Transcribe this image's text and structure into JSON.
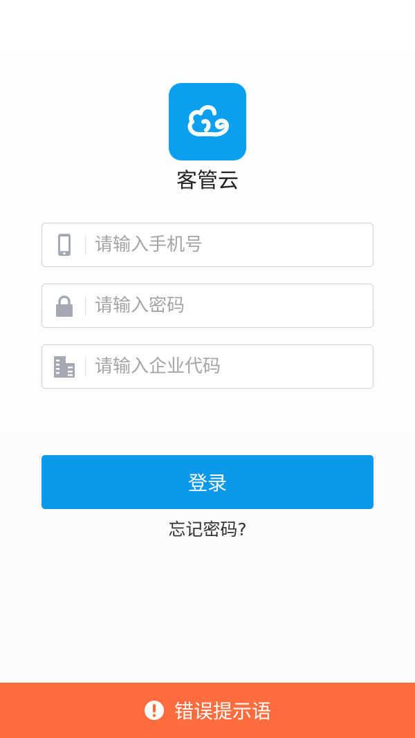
{
  "app": {
    "name": "客管云",
    "brand_color": "#0aa0ef",
    "logo_icon": "cloud-logo-icon"
  },
  "form": {
    "phone": {
      "placeholder": "请输入手机号",
      "value": "",
      "icon": "phone-icon"
    },
    "password": {
      "placeholder": "请输入密码",
      "value": "",
      "icon": "lock-icon"
    },
    "company": {
      "placeholder": "请输入企业代码",
      "value": "",
      "icon": "building-icon"
    },
    "icon_color": "#a4a9b3"
  },
  "actions": {
    "login_label": "登录",
    "login_color": "#0998ea",
    "forgot_label": "忘记密码?"
  },
  "error": {
    "message": "错误提示语",
    "icon": "exclamation-circle-icon",
    "color": "#ff6d3f"
  }
}
